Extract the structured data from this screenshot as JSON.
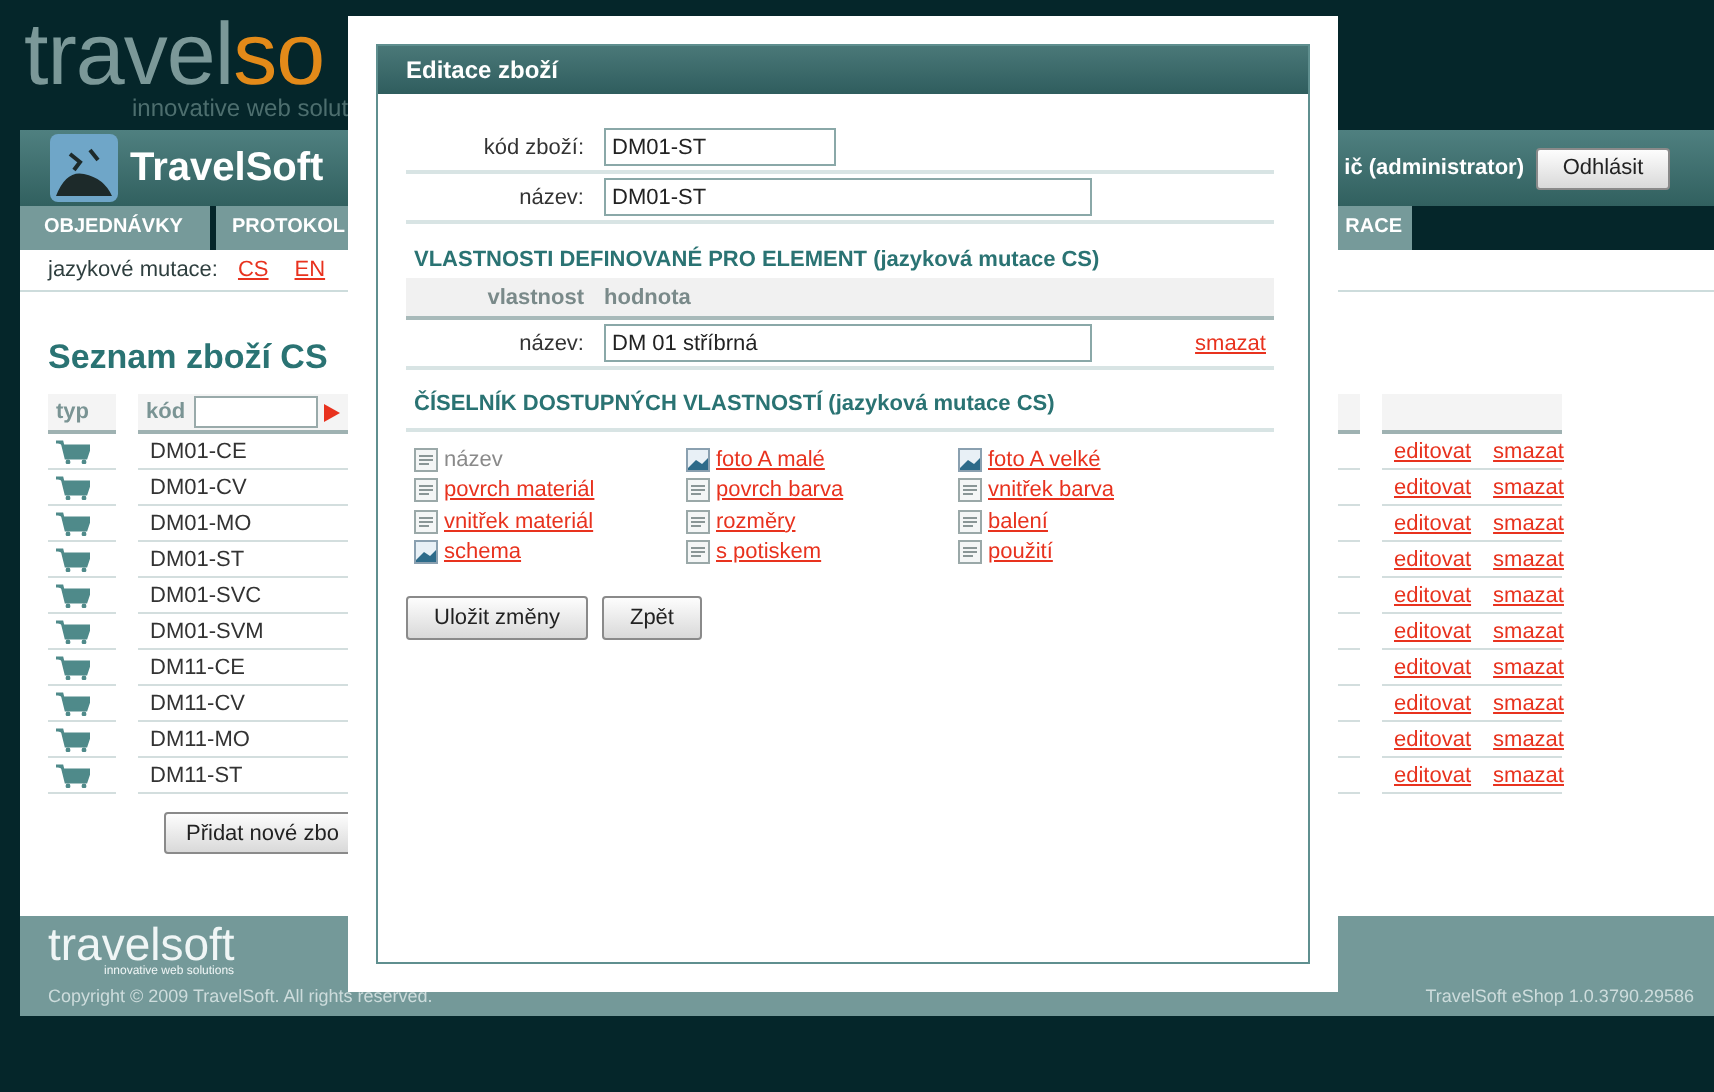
{
  "header": {
    "logo_a": "travel",
    "logo_b": "so",
    "tagline": "innovative web solut"
  },
  "app_bar": {
    "title": "TravelSoft",
    "user": "ič (administrator)",
    "logout": "Odhlásit"
  },
  "nav": {
    "tabs": [
      {
        "label": "OBJEDNÁVKY"
      },
      {
        "label": "PROTOKOL"
      },
      {
        "label": "RACE"
      }
    ]
  },
  "languages": {
    "label": "jazykové mutace:",
    "links": [
      "CS",
      "EN"
    ]
  },
  "list": {
    "title": "Seznam zboží CS",
    "columns": [
      "typ",
      "kód"
    ],
    "rows": [
      {
        "code": "DM01-CE",
        "edit": "editovat",
        "delete": "smazat"
      },
      {
        "code": "DM01-CV",
        "edit": "editovat",
        "delete": "smazat"
      },
      {
        "code": "DM01-MO",
        "edit": "editovat",
        "delete": "smazat"
      },
      {
        "code": "DM01-ST",
        "edit": "editovat",
        "delete": "smazat"
      },
      {
        "code": "DM01-SVC",
        "edit": "editovat",
        "delete": "smazat"
      },
      {
        "code": "DM01-SVM",
        "edit": "editovat",
        "delete": "smazat"
      },
      {
        "code": "DM11-CE",
        "edit": "editovat",
        "delete": "smazat"
      },
      {
        "code": "DM11-CV",
        "edit": "editovat",
        "delete": "smazat"
      },
      {
        "code": "DM11-MO",
        "edit": "editovat",
        "delete": "smazat"
      },
      {
        "code": "DM11-ST",
        "edit": "editovat",
        "delete": "smazat"
      }
    ],
    "add_button": "Přidat nové zbo"
  },
  "footer": {
    "logo": "travelsoft",
    "tagline": "innovative web solutions",
    "copyright": "Copyright © 2009 TravelSoft. All rights reserved.",
    "version": "TravelSoft eShop 1.0.3790.29586"
  },
  "dialog": {
    "title": "Editace zboží",
    "fields": [
      {
        "label": "kód zboží:",
        "value": "DM01-ST"
      },
      {
        "label": "název:",
        "value": "DM01-ST"
      }
    ],
    "defined_heading": "VLASTNOSTI DEFINOVANÉ PRO ELEMENT (jazyková mutace CS)",
    "defined_columns": [
      "vlastnost",
      "hodnota"
    ],
    "defined": [
      {
        "label": "název:",
        "value": "DM 01 stříbrná",
        "delete": "smazat"
      }
    ],
    "catalog_heading": "ČÍSELNÍK DOSTUPNÝCH VLASTNOSTÍ (jazyková mutace CS)",
    "catalog": [
      {
        "label": "název",
        "kind": "text",
        "disabled": true
      },
      {
        "label": "povrch materiál",
        "kind": "text",
        "disabled": false
      },
      {
        "label": "vnitřek materiál",
        "kind": "text",
        "disabled": false
      },
      {
        "label": "schema",
        "kind": "image",
        "disabled": false
      },
      {
        "label": "foto A malé",
        "kind": "image",
        "disabled": false
      },
      {
        "label": "povrch barva",
        "kind": "text",
        "disabled": false
      },
      {
        "label": "rozměry",
        "kind": "text",
        "disabled": false
      },
      {
        "label": "s potiskem",
        "kind": "text",
        "disabled": false
      },
      {
        "label": "foto A velké",
        "kind": "image",
        "disabled": false
      },
      {
        "label": "vnitřek barva",
        "kind": "text",
        "disabled": false
      },
      {
        "label": "balení",
        "kind": "text",
        "disabled": false
      },
      {
        "label": "použití",
        "kind": "text",
        "disabled": false
      }
    ],
    "buttons": [
      "Uložit změny",
      "Zpět"
    ]
  }
}
